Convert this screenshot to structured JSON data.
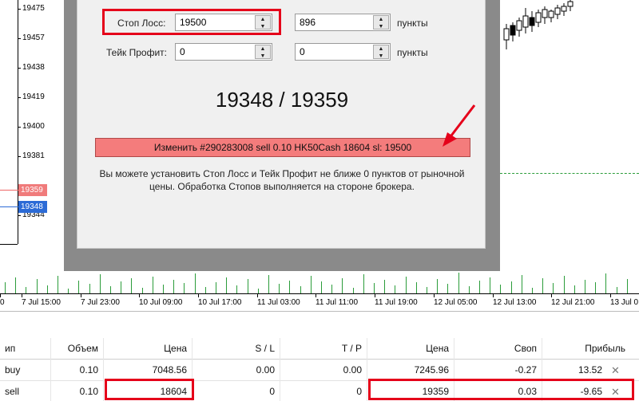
{
  "price_axis": {
    "ticks": [
      "19475",
      "19457",
      "19438",
      "19419",
      "19400",
      "19381",
      "19344"
    ],
    "ask_marker": "19359",
    "bid_marker": "19348"
  },
  "dialog": {
    "stop_loss_label": "Стоп Лосс:",
    "stop_loss_value": "19500",
    "stop_loss_points": "896",
    "take_profit_label": "Тейк Профит:",
    "take_profit_value": "0",
    "take_profit_points": "0",
    "points_label": "пункты",
    "quote": "19348 / 19359",
    "modify_button": "Изменить #290283008 sell 0.10 HK50Cash 18604 sl: 19500",
    "hint_line1": "Вы можете установить Стоп Лосс и Тейк Профит не ближе 0 пунктов от рыночной",
    "hint_line2": "цены. Обработка Стопов выполняется на стороне брокера."
  },
  "time_axis": [
    "0",
    "7 Jul 15:00",
    "7 Jul 23:00",
    "10 Jul 09:00",
    "10 Jul 17:00",
    "11 Jul 03:00",
    "11 Jul 11:00",
    "11 Jul 19:00",
    "12 Jul 05:00",
    "12 Jul 13:00",
    "12 Jul 21:00",
    "13 Jul 0"
  ],
  "table": {
    "headers": [
      "ип",
      "Объем",
      "Цена",
      "S / L",
      "T / P",
      "Цена",
      "Своп",
      "Прибыль"
    ],
    "rows": [
      {
        "type": "buy",
        "volume": "0.10",
        "price": "7048.56",
        "sl": "0.00",
        "tp": "0.00",
        "current": "7245.96",
        "swap": "-0.27",
        "profit": "13.52",
        "close": "✕"
      },
      {
        "type": "sell",
        "volume": "0.10",
        "price": "18604",
        "sl": "0",
        "tp": "0",
        "current": "19359",
        "swap": "0.03",
        "profit": "-9.65",
        "close": "✕"
      }
    ]
  },
  "colors": {
    "highlight": "#e5001a",
    "modify_button_bg": "#f47c7c",
    "ask": "#f07b7b",
    "bid": "#2c6bd6",
    "volume": "#2b9c3a"
  }
}
